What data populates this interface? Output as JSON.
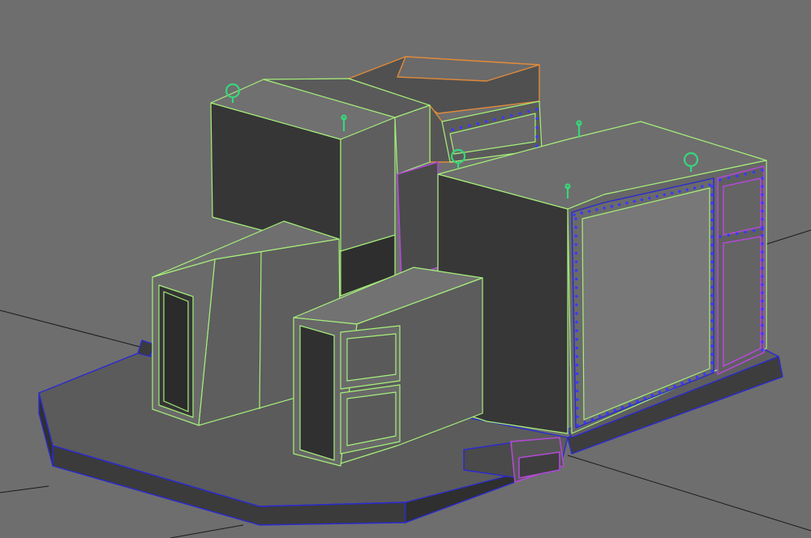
{
  "viewport": {
    "background": "#6e6e6e",
    "selection_color": "#a6f07a",
    "base_wire_color": "#2a2ad0",
    "highlight_color": "#b24ad6",
    "orange_wire_color": "#e08a3a",
    "gizmo_color": "#37d67a",
    "grid_color": "#1a1a1a"
  },
  "icons": [
    "lift-ring-icon",
    "lift-bolt-icon"
  ]
}
